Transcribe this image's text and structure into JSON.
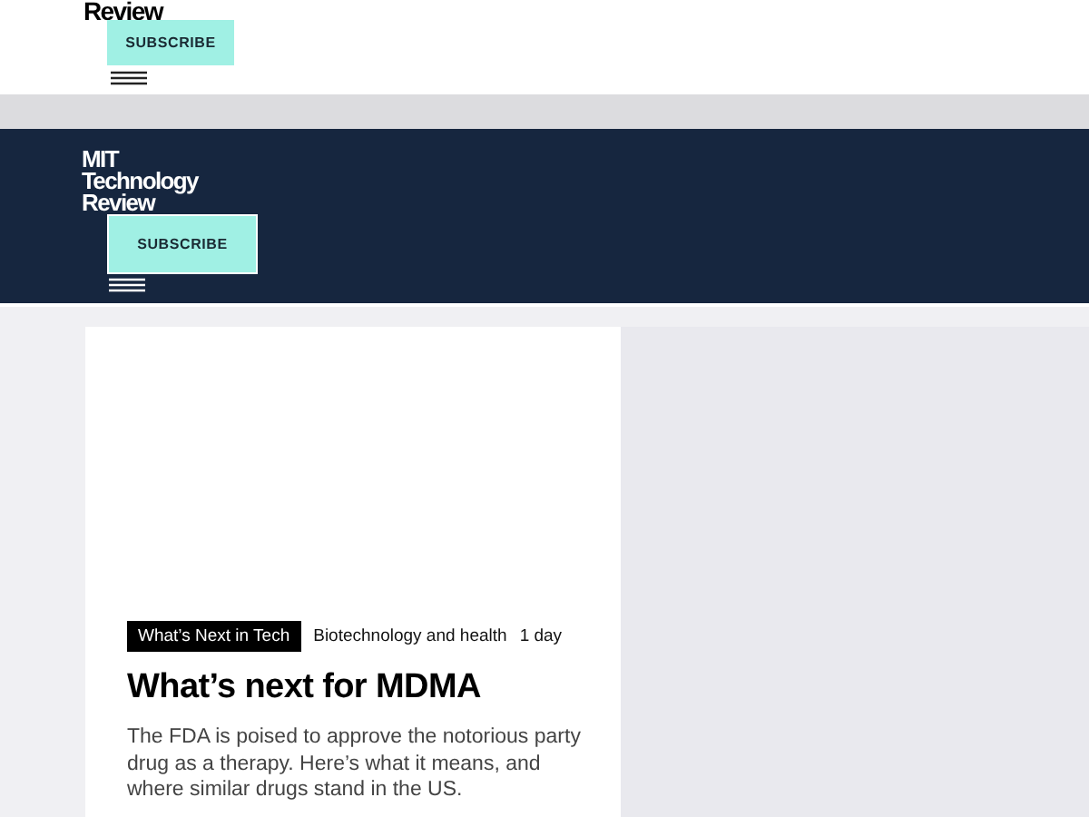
{
  "masthead_top": {
    "logo": [
      "Review"
    ],
    "subscribe": "SUBSCRIBE"
  },
  "masthead": {
    "logo": [
      "MIT",
      "Technology",
      "Review"
    ],
    "subscribe": "SUBSCRIBE"
  },
  "article": {
    "tag": "What’s Next in Tech",
    "topic": "Biotechnology and health",
    "age": "1 day",
    "title": "What’s next for MDMA",
    "summary": "The FDA is poised to approve the notorious party drug as a therapy. Here’s what it means, and where similar drugs stand in the US."
  }
}
